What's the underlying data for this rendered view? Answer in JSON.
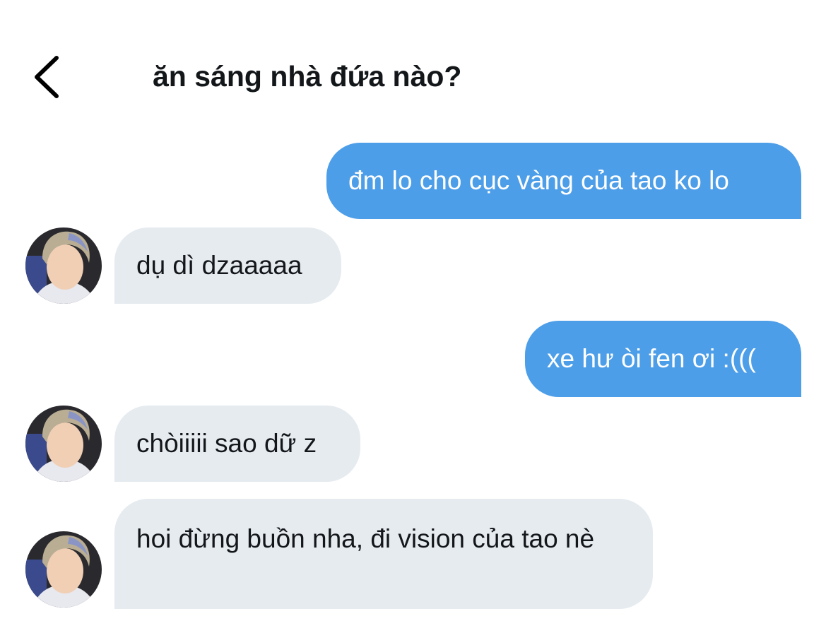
{
  "header": {
    "title": "ăn sáng nhà đứa nào?",
    "back_icon": "chevron-left-icon"
  },
  "messages": [
    {
      "direction": "sent",
      "text": "đm lo cho cục vàng của tao ko lo"
    },
    {
      "direction": "received",
      "text": "dụ dì dzaaaaa"
    },
    {
      "direction": "sent",
      "text": "xe hư òi fen ơi :((("
    },
    {
      "direction": "received",
      "text": "chòiiiii sao dữ z"
    },
    {
      "direction": "received",
      "text": "hoi đừng buồn nha, đi vision của tao nè"
    }
  ],
  "colors": {
    "sent_bubble": "#4d9ee8",
    "received_bubble": "#e6ebf0",
    "text_dark": "#14171a"
  }
}
